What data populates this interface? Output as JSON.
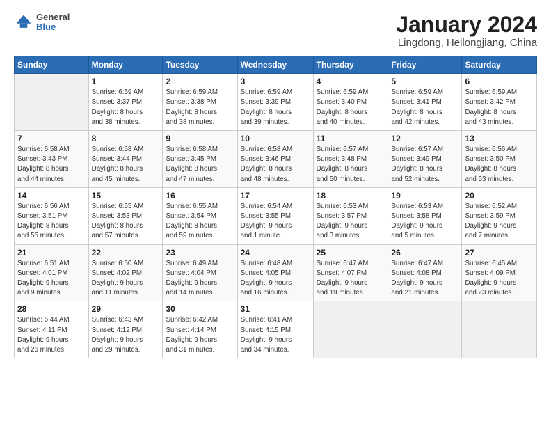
{
  "header": {
    "logo_general": "General",
    "logo_blue": "Blue",
    "month_title": "January 2024",
    "subtitle": "Lingdong, Heilongjiang, China"
  },
  "days_of_week": [
    "Sunday",
    "Monday",
    "Tuesday",
    "Wednesday",
    "Thursday",
    "Friday",
    "Saturday"
  ],
  "weeks": [
    [
      {
        "day": "",
        "info": ""
      },
      {
        "day": "1",
        "info": "Sunrise: 6:59 AM\nSunset: 3:37 PM\nDaylight: 8 hours\nand 38 minutes."
      },
      {
        "day": "2",
        "info": "Sunrise: 6:59 AM\nSunset: 3:38 PM\nDaylight: 8 hours\nand 38 minutes."
      },
      {
        "day": "3",
        "info": "Sunrise: 6:59 AM\nSunset: 3:39 PM\nDaylight: 8 hours\nand 39 minutes."
      },
      {
        "day": "4",
        "info": "Sunrise: 6:59 AM\nSunset: 3:40 PM\nDaylight: 8 hours\nand 40 minutes."
      },
      {
        "day": "5",
        "info": "Sunrise: 6:59 AM\nSunset: 3:41 PM\nDaylight: 8 hours\nand 42 minutes."
      },
      {
        "day": "6",
        "info": "Sunrise: 6:59 AM\nSunset: 3:42 PM\nDaylight: 8 hours\nand 43 minutes."
      }
    ],
    [
      {
        "day": "7",
        "info": "Sunrise: 6:58 AM\nSunset: 3:43 PM\nDaylight: 8 hours\nand 44 minutes."
      },
      {
        "day": "8",
        "info": "Sunrise: 6:58 AM\nSunset: 3:44 PM\nDaylight: 8 hours\nand 45 minutes."
      },
      {
        "day": "9",
        "info": "Sunrise: 6:58 AM\nSunset: 3:45 PM\nDaylight: 8 hours\nand 47 minutes."
      },
      {
        "day": "10",
        "info": "Sunrise: 6:58 AM\nSunset: 3:46 PM\nDaylight: 8 hours\nand 48 minutes."
      },
      {
        "day": "11",
        "info": "Sunrise: 6:57 AM\nSunset: 3:48 PM\nDaylight: 8 hours\nand 50 minutes."
      },
      {
        "day": "12",
        "info": "Sunrise: 6:57 AM\nSunset: 3:49 PM\nDaylight: 8 hours\nand 52 minutes."
      },
      {
        "day": "13",
        "info": "Sunrise: 6:56 AM\nSunset: 3:50 PM\nDaylight: 8 hours\nand 53 minutes."
      }
    ],
    [
      {
        "day": "14",
        "info": "Sunrise: 6:56 AM\nSunset: 3:51 PM\nDaylight: 8 hours\nand 55 minutes."
      },
      {
        "day": "15",
        "info": "Sunrise: 6:55 AM\nSunset: 3:53 PM\nDaylight: 8 hours\nand 57 minutes."
      },
      {
        "day": "16",
        "info": "Sunrise: 6:55 AM\nSunset: 3:54 PM\nDaylight: 8 hours\nand 59 minutes."
      },
      {
        "day": "17",
        "info": "Sunrise: 6:54 AM\nSunset: 3:55 PM\nDaylight: 9 hours\nand 1 minute."
      },
      {
        "day": "18",
        "info": "Sunrise: 6:53 AM\nSunset: 3:57 PM\nDaylight: 9 hours\nand 3 minutes."
      },
      {
        "day": "19",
        "info": "Sunrise: 6:53 AM\nSunset: 3:58 PM\nDaylight: 9 hours\nand 5 minutes."
      },
      {
        "day": "20",
        "info": "Sunrise: 6:52 AM\nSunset: 3:59 PM\nDaylight: 9 hours\nand 7 minutes."
      }
    ],
    [
      {
        "day": "21",
        "info": "Sunrise: 6:51 AM\nSunset: 4:01 PM\nDaylight: 9 hours\nand 9 minutes."
      },
      {
        "day": "22",
        "info": "Sunrise: 6:50 AM\nSunset: 4:02 PM\nDaylight: 9 hours\nand 11 minutes."
      },
      {
        "day": "23",
        "info": "Sunrise: 6:49 AM\nSunset: 4:04 PM\nDaylight: 9 hours\nand 14 minutes."
      },
      {
        "day": "24",
        "info": "Sunrise: 6:48 AM\nSunset: 4:05 PM\nDaylight: 9 hours\nand 16 minutes."
      },
      {
        "day": "25",
        "info": "Sunrise: 6:47 AM\nSunset: 4:07 PM\nDaylight: 9 hours\nand 19 minutes."
      },
      {
        "day": "26",
        "info": "Sunrise: 6:47 AM\nSunset: 4:08 PM\nDaylight: 9 hours\nand 21 minutes."
      },
      {
        "day": "27",
        "info": "Sunrise: 6:45 AM\nSunset: 4:09 PM\nDaylight: 9 hours\nand 23 minutes."
      }
    ],
    [
      {
        "day": "28",
        "info": "Sunrise: 6:44 AM\nSunset: 4:11 PM\nDaylight: 9 hours\nand 26 minutes."
      },
      {
        "day": "29",
        "info": "Sunrise: 6:43 AM\nSunset: 4:12 PM\nDaylight: 9 hours\nand 29 minutes."
      },
      {
        "day": "30",
        "info": "Sunrise: 6:42 AM\nSunset: 4:14 PM\nDaylight: 9 hours\nand 31 minutes."
      },
      {
        "day": "31",
        "info": "Sunrise: 6:41 AM\nSunset: 4:15 PM\nDaylight: 9 hours\nand 34 minutes."
      },
      {
        "day": "",
        "info": ""
      },
      {
        "day": "",
        "info": ""
      },
      {
        "day": "",
        "info": ""
      }
    ]
  ]
}
